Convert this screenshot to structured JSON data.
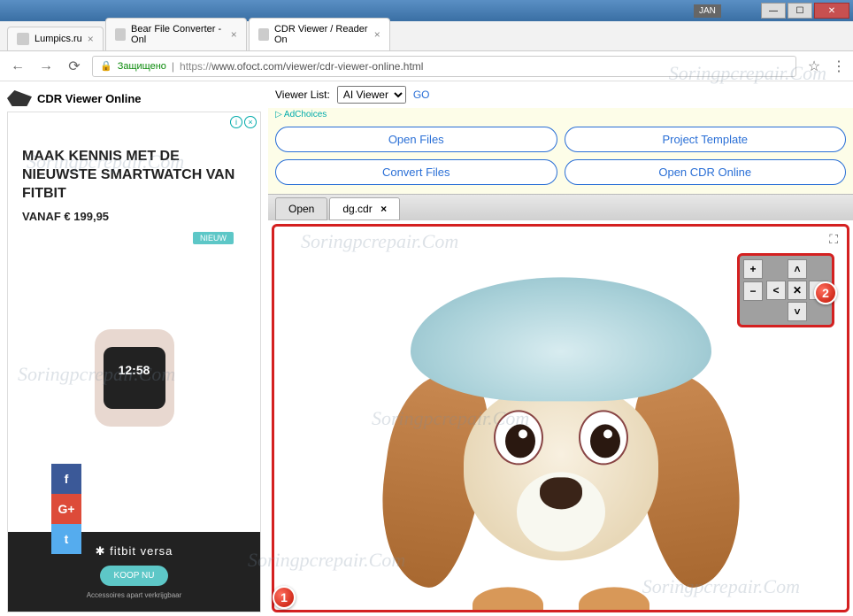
{
  "titlebar": {
    "lang": "JAN"
  },
  "tabs": [
    {
      "title": "Lumpics.ru"
    },
    {
      "title": "Bear File Converter - Onl"
    },
    {
      "title": "CDR Viewer / Reader On"
    }
  ],
  "addressbar": {
    "secure_label": "Защищено",
    "url_prefix": "https://",
    "url_rest": "www.ofoct.com/viewer/cdr-viewer-online.html"
  },
  "site": {
    "title": "CDR Viewer Online"
  },
  "viewer_list": {
    "label": "Viewer List:",
    "selected": "AI Viewer",
    "go": "GO"
  },
  "adchoices": "AdChoices",
  "action_buttons": {
    "open_files": "Open Files",
    "project_template": "Project Template",
    "convert_files": "Convert Files",
    "open_cdr_online": "Open CDR Online"
  },
  "file_tabs": {
    "open": "Open",
    "current": "dg.cdr"
  },
  "ad": {
    "headline": "MAAK KENNIS MET DE NIEUWSTE SMARTWATCH VAN FITBIT",
    "price": "VANAF € 199,95",
    "badge": "NIEUW",
    "watch_time": "12:58",
    "brand": "✱ fitbit versa",
    "cta": "KOOP NU",
    "fine": "Accessoires apart verkrijgbaar"
  },
  "social": {
    "fb": "f",
    "gp": "G+",
    "tw": "t"
  },
  "nav_control": {
    "zoom_in": "+",
    "zoom_out": "−",
    "up": "˄",
    "left": "˂",
    "center": "✕",
    "right": "˃",
    "down": "˅"
  },
  "callouts": {
    "one": "1",
    "two": "2"
  },
  "watermark": "Soringpcrepair.Com"
}
